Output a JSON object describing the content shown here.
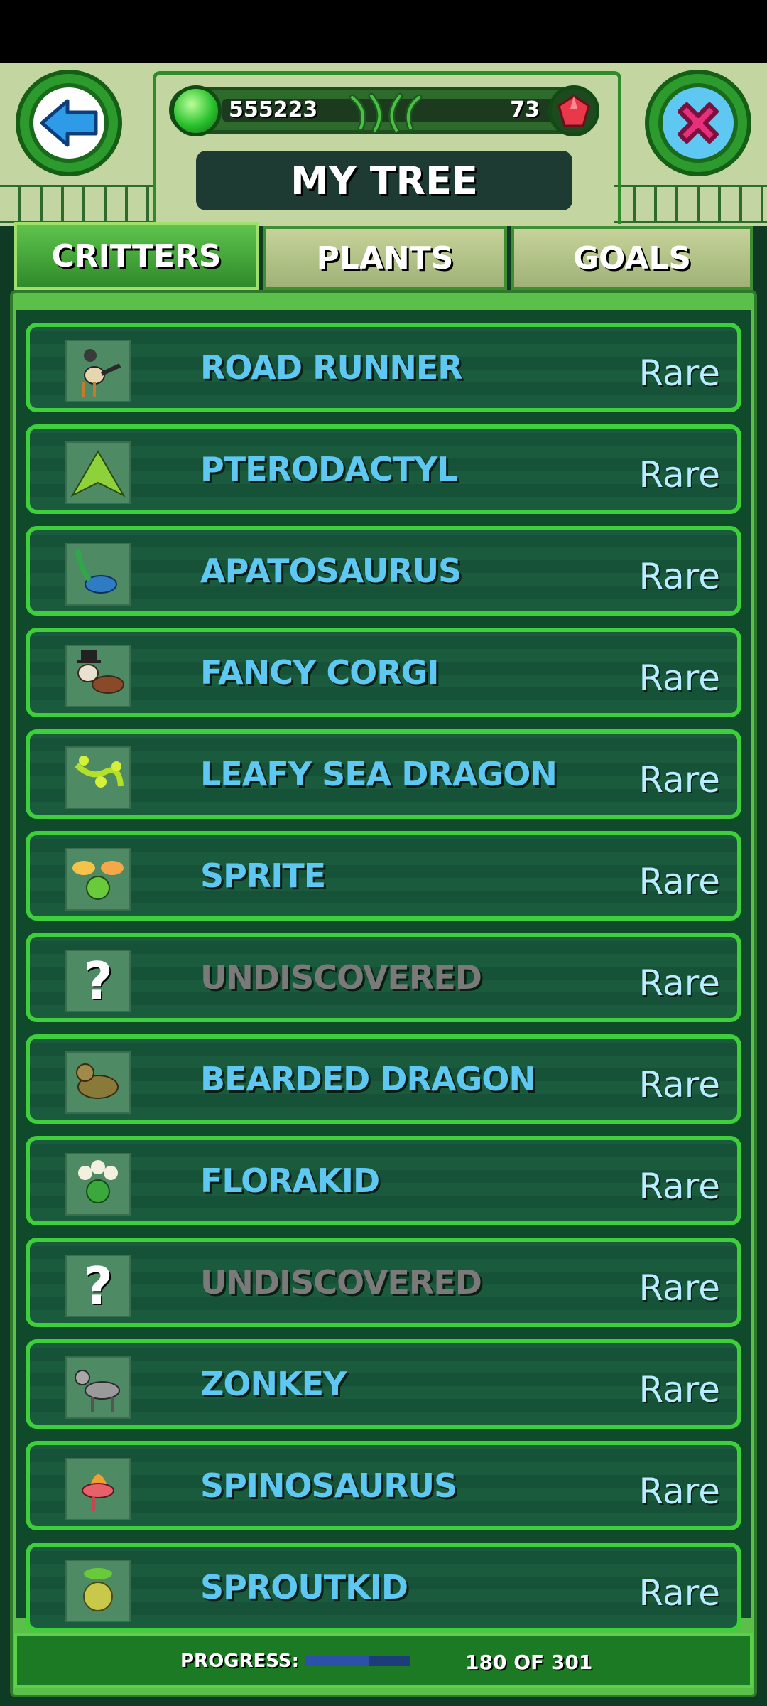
{
  "header": {
    "coins": "555223",
    "gems": "73",
    "title": "MY TREE"
  },
  "tabs": [
    {
      "label": "CRITTERS",
      "active": true
    },
    {
      "label": "PLANTS",
      "active": false
    },
    {
      "label": "GOALS",
      "active": false
    }
  ],
  "critters": [
    {
      "name": "ROAD RUNNER",
      "rarity": "Rare",
      "discovered": true
    },
    {
      "name": "PTERODACTYL",
      "rarity": "Rare",
      "discovered": true
    },
    {
      "name": "APATOSAURUS",
      "rarity": "Rare",
      "discovered": true
    },
    {
      "name": "FANCY CORGI",
      "rarity": "Rare",
      "discovered": true
    },
    {
      "name": "LEAFY SEA DRAGON",
      "rarity": "Rare",
      "discovered": true
    },
    {
      "name": "SPRITE",
      "rarity": "Rare",
      "discovered": true
    },
    {
      "name": "UNDISCOVERED",
      "rarity": "Rare",
      "discovered": false
    },
    {
      "name": "BEARDED DRAGON",
      "rarity": "Rare",
      "discovered": true
    },
    {
      "name": "FLORAKID",
      "rarity": "Rare",
      "discovered": true
    },
    {
      "name": "UNDISCOVERED",
      "rarity": "Rare",
      "discovered": false
    },
    {
      "name": "ZONKEY",
      "rarity": "Rare",
      "discovered": true
    },
    {
      "name": "SPINOSAURUS",
      "rarity": "Rare",
      "discovered": true
    },
    {
      "name": "SPROUTKID",
      "rarity": "Rare",
      "discovered": true
    }
  ],
  "footer": {
    "progress_label": "PROGRESS:",
    "progress_text": "180 OF 301",
    "progress_fraction": 0.598
  },
  "colors": {
    "accent_green": "#3fcf3c",
    "name_blue": "#5fc8f2",
    "undiscovered_gray": "#7a7a7a"
  }
}
